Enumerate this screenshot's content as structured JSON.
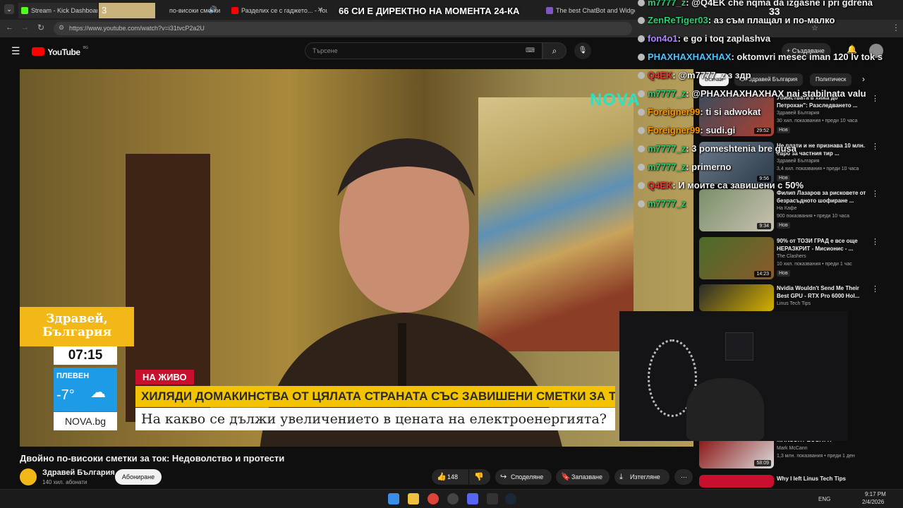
{
  "browser": {
    "tabs": [
      {
        "label": "Stream - Kick Dashboard"
      },
      {
        "label": "3"
      },
      {
        "label": "по-високи сметки"
      },
      {
        "label": "Разделих се с гаджето... - YouT"
      },
      {
        "label": "The best ChatBot and Widgets"
      }
    ],
    "url": "https://www.youtube.com/watch?v=i31tvcP2a2U"
  },
  "stream_overlay": {
    "title": "66 СИ Е ДИРЕКТНО НА МОМЕНТА 24-КА",
    "viewers": "33"
  },
  "youtube": {
    "logo_text": "YouTube",
    "logo_region": "BG",
    "search_placeholder": "Търсене",
    "create_label": "Създаване",
    "video": {
      "title": "Двойно по-високи сметки за ток: Недоволство и протести",
      "live_badge": "НА ЖИВО",
      "headline": "ХИЛЯДИ ДОМАКИНСТВА ОТ ЦЯЛАТА СТРАНАТА СЪС ЗАВИШЕНИ СМЕТКИ ЗА ТОК",
      "subline": "На какво се дължи увеличението в цената на електроенергията?",
      "show_logo": "Здравей, България",
      "clock": "07:15",
      "city": "ПЛЕВЕН",
      "temperature": "-7°",
      "site": "NOVA.bg",
      "channel_logo": "NOVA"
    },
    "channel": {
      "name": "Здравей България",
      "subscribers": "140 хил. абонати",
      "subscribe_label": "Абониране"
    },
    "actions": {
      "likes": "148",
      "share": "Споделяне",
      "save": "Запазване",
      "download": "Изтегляне"
    },
    "chips": [
      "Всички",
      "От Здравей България",
      "Политическ"
    ],
    "recommendations": [
      {
        "title": "Убийствата в хижа до Петрохан\": Разследването ...",
        "channel": "Здравей България",
        "meta": "30 хил. показвания • преди 10 часа",
        "duration": "29:52",
        "badge": "Нов"
      },
      {
        "title": "Не плати и не признава 10 млн. евро за частния тир ...",
        "channel": "Здравей България",
        "meta": "3,4 хил. показвания • преди 10 часа",
        "duration": "9:56",
        "badge": "Нов"
      },
      {
        "title": "Филип Лазаров за рисковете от безрасъдното шофиране ...",
        "channel": "На Кафе",
        "meta": "900 показвания • преди 10 часа",
        "duration": "9:34",
        "badge": "Нов"
      },
      {
        "title": "90% от ТОЗИ ГРАД е все още НЕРАЗКРИТ - Мисионис - ...",
        "channel": "The Clashers",
        "meta": "10 хил. показвания • преди 1 час",
        "duration": "14:23",
        "badge": "Нов"
      },
      {
        "title": "Nvidia Wouldn't Send Me Their Best GPU - RTX Pro 6000 Hol...",
        "channel": "Linus Tech Tips",
        "meta": "",
        "duration": "",
        "badge": ""
      },
      {
        "title": "MANSORY BUGATTI",
        "channel": "Mark McCann",
        "meta": "1,3 млн. показвания • преди 1 ден",
        "duration": "58:09",
        "badge": ""
      },
      {
        "title": "Why I left Linus Tech Tips",
        "channel": "",
        "meta": "",
        "duration": "",
        "badge": ""
      }
    ]
  },
  "chat": [
    {
      "user": "m7777_z",
      "message": ": @Q4EK che nqma da izgasne i pri gdrena",
      "color": "#2ecc71"
    },
    {
      "user": "ZenReTiger03",
      "message": ": аз съм плащал и по-малко",
      "color": "#2ecc71"
    },
    {
      "user": "fon4o1",
      "message": ": e go i toq zaplashva",
      "color": "#b388ff"
    },
    {
      "user": "PHAXHAXHAXHAX",
      "message": ": oktomvri mesec iman 120 lv tok s",
      "color": "#4fc3f7"
    },
    {
      "user": "Q4EK",
      "message": ": @m7777_z з здр",
      "color": "#e53935"
    },
    {
      "user": "m7777_z",
      "message": ": @PHAXHAXHAXHAX nai stabilnata valu",
      "color": "#2ecc71"
    },
    {
      "user": "Foreigner99",
      "message": ": ti si adwokat",
      "color": "#ff9800"
    },
    {
      "user": "Foreigner99",
      "message": ": sudi.gi",
      "color": "#ff9800"
    },
    {
      "user": "m7777_z",
      "message": ": 3 pomeshtenia bre gusa",
      "color": "#2ecc71"
    },
    {
      "user": "m7777_z",
      "message": ": primerno",
      "color": "#2ecc71"
    },
    {
      "user": "Q4EK",
      "message": ": И моите са завишени с 50%",
      "color": "#e53935"
    },
    {
      "user": "m7777_z",
      "message": "",
      "color": "#2ecc71"
    }
  ],
  "taskbar": {
    "language": "ENG",
    "time": "9:17 PM",
    "date": "2/4/2026"
  },
  "colors": {
    "yt_bg": "#0f0f0f",
    "headline_yellow": "#f4c300",
    "live_red": "#c8102e",
    "nova_teal": "#2ee0c2"
  }
}
